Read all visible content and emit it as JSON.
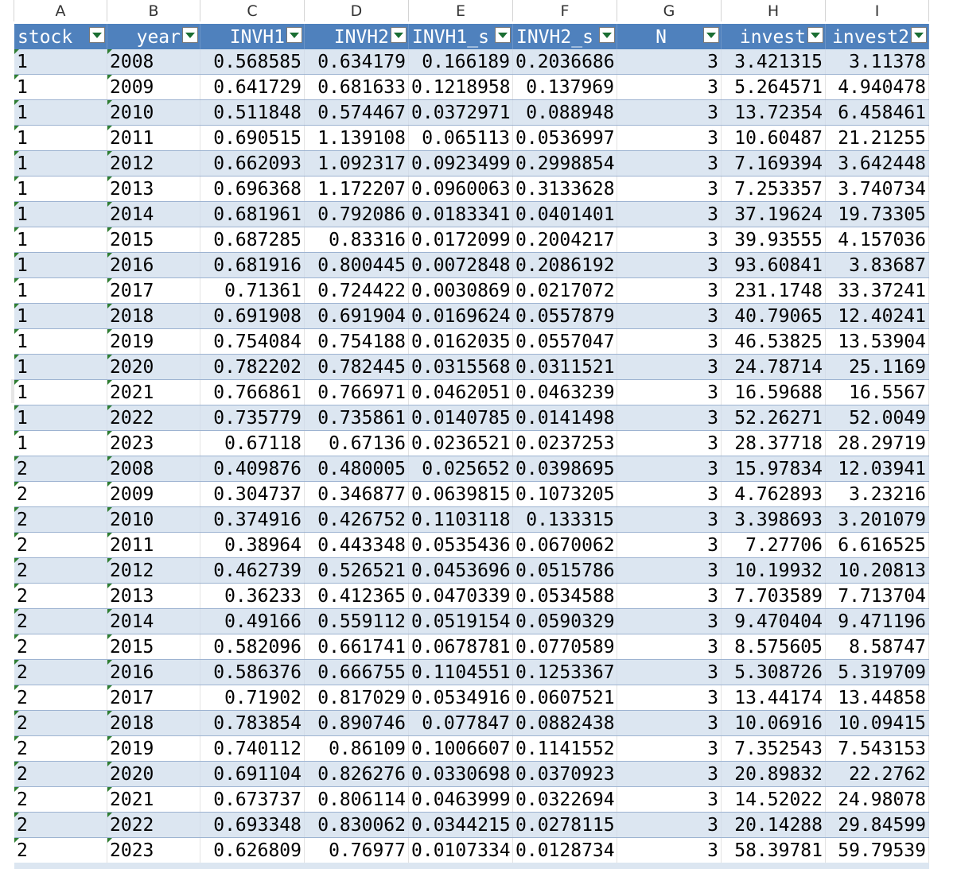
{
  "columns": [
    "A",
    "B",
    "C",
    "D",
    "E",
    "F",
    "G",
    "H",
    "I"
  ],
  "headers": [
    "stock",
    "year",
    "INVH1",
    "INVH2",
    "INVH1_s",
    "INVH2_s",
    "N",
    "invest",
    "invest2"
  ],
  "rows": [
    [
      "1",
      "2008",
      "0.568585",
      "0.634179",
      "0.166189",
      "0.2036686",
      "3",
      "3.421315",
      "3.11378"
    ],
    [
      "1",
      "2009",
      "0.641729",
      "0.681633",
      "0.1218958",
      "0.137969",
      "3",
      "5.264571",
      "4.940478"
    ],
    [
      "1",
      "2010",
      "0.511848",
      "0.574467",
      "0.0372971",
      "0.088948",
      "3",
      "13.72354",
      "6.458461"
    ],
    [
      "1",
      "2011",
      "0.690515",
      "1.139108",
      "0.065113",
      "0.0536997",
      "3",
      "10.60487",
      "21.21255"
    ],
    [
      "1",
      "2012",
      "0.662093",
      "1.092317",
      "0.0923499",
      "0.2998854",
      "3",
      "7.169394",
      "3.642448"
    ],
    [
      "1",
      "2013",
      "0.696368",
      "1.172207",
      "0.0960063",
      "0.3133628",
      "3",
      "7.253357",
      "3.740734"
    ],
    [
      "1",
      "2014",
      "0.681961",
      "0.792086",
      "0.0183341",
      "0.0401401",
      "3",
      "37.19624",
      "19.73305"
    ],
    [
      "1",
      "2015",
      "0.687285",
      "0.83316",
      "0.0172099",
      "0.2004217",
      "3",
      "39.93555",
      "4.157036"
    ],
    [
      "1",
      "2016",
      "0.681916",
      "0.800445",
      "0.0072848",
      "0.2086192",
      "3",
      "93.60841",
      "3.83687"
    ],
    [
      "1",
      "2017",
      "0.71361",
      "0.724422",
      "0.0030869",
      "0.0217072",
      "3",
      "231.1748",
      "33.37241"
    ],
    [
      "1",
      "2018",
      "0.691908",
      "0.691904",
      "0.0169624",
      "0.0557879",
      "3",
      "40.79065",
      "12.40241"
    ],
    [
      "1",
      "2019",
      "0.754084",
      "0.754188",
      "0.0162035",
      "0.0557047",
      "3",
      "46.53825",
      "13.53904"
    ],
    [
      "1",
      "2020",
      "0.782202",
      "0.782445",
      "0.0315568",
      "0.0311521",
      "3",
      "24.78714",
      "25.1169"
    ],
    [
      "1",
      "2021",
      "0.766861",
      "0.766971",
      "0.0462051",
      "0.0463239",
      "3",
      "16.59688",
      "16.5567"
    ],
    [
      "1",
      "2022",
      "0.735779",
      "0.735861",
      "0.0140785",
      "0.0141498",
      "3",
      "52.26271",
      "52.0049"
    ],
    [
      "1",
      "2023",
      "0.67118",
      "0.67136",
      "0.0236521",
      "0.0237253",
      "3",
      "28.37718",
      "28.29719"
    ],
    [
      "2",
      "2008",
      "0.409876",
      "0.480005",
      "0.025652",
      "0.0398695",
      "3",
      "15.97834",
      "12.03941"
    ],
    [
      "2",
      "2009",
      "0.304737",
      "0.346877",
      "0.0639815",
      "0.1073205",
      "3",
      "4.762893",
      "3.23216"
    ],
    [
      "2",
      "2010",
      "0.374916",
      "0.426752",
      "0.1103118",
      "0.133315",
      "3",
      "3.398693",
      "3.201079"
    ],
    [
      "2",
      "2011",
      "0.38964",
      "0.443348",
      "0.0535436",
      "0.0670062",
      "3",
      "7.27706",
      "6.616525"
    ],
    [
      "2",
      "2012",
      "0.462739",
      "0.526521",
      "0.0453696",
      "0.0515786",
      "3",
      "10.19932",
      "10.20813"
    ],
    [
      "2",
      "2013",
      "0.36233",
      "0.412365",
      "0.0470339",
      "0.0534588",
      "3",
      "7.703589",
      "7.713704"
    ],
    [
      "2",
      "2014",
      "0.49166",
      "0.559112",
      "0.0519154",
      "0.0590329",
      "3",
      "9.470404",
      "9.471196"
    ],
    [
      "2",
      "2015",
      "0.582096",
      "0.661741",
      "0.0678781",
      "0.0770589",
      "3",
      "8.575605",
      "8.58747"
    ],
    [
      "2",
      "2016",
      "0.586376",
      "0.666755",
      "0.1104551",
      "0.1253367",
      "3",
      "5.308726",
      "5.319709"
    ],
    [
      "2",
      "2017",
      "0.71902",
      "0.817029",
      "0.0534916",
      "0.0607521",
      "3",
      "13.44174",
      "13.44858"
    ],
    [
      "2",
      "2018",
      "0.783854",
      "0.890746",
      "0.077847",
      "0.0882438",
      "3",
      "10.06916",
      "10.09415"
    ],
    [
      "2",
      "2019",
      "0.740112",
      "0.86109",
      "0.1006607",
      "0.1141552",
      "3",
      "7.352543",
      "7.543153"
    ],
    [
      "2",
      "2020",
      "0.691104",
      "0.826276",
      "0.0330698",
      "0.0370923",
      "3",
      "20.89832",
      "22.2762"
    ],
    [
      "2",
      "2021",
      "0.673737",
      "0.806114",
      "0.0463999",
      "0.0322694",
      "3",
      "14.52022",
      "24.98078"
    ],
    [
      "2",
      "2022",
      "0.693348",
      "0.830062",
      "0.0344215",
      "0.0278115",
      "3",
      "20.14288",
      "29.84599"
    ],
    [
      "2",
      "2023",
      "0.626809",
      "0.76977",
      "0.0107334",
      "0.0128734",
      "3",
      "58.39781",
      "59.79539"
    ]
  ],
  "colors": {
    "header_bg": "#4f81bd",
    "band_bg": "#dce6f1",
    "header_text": "#ffffff",
    "filter_arrow": "#1a6e32",
    "error_tick": "#2e7d32"
  },
  "icons": {
    "filter": "filter-dropdown-icon",
    "tick": "error-indicator-icon"
  }
}
